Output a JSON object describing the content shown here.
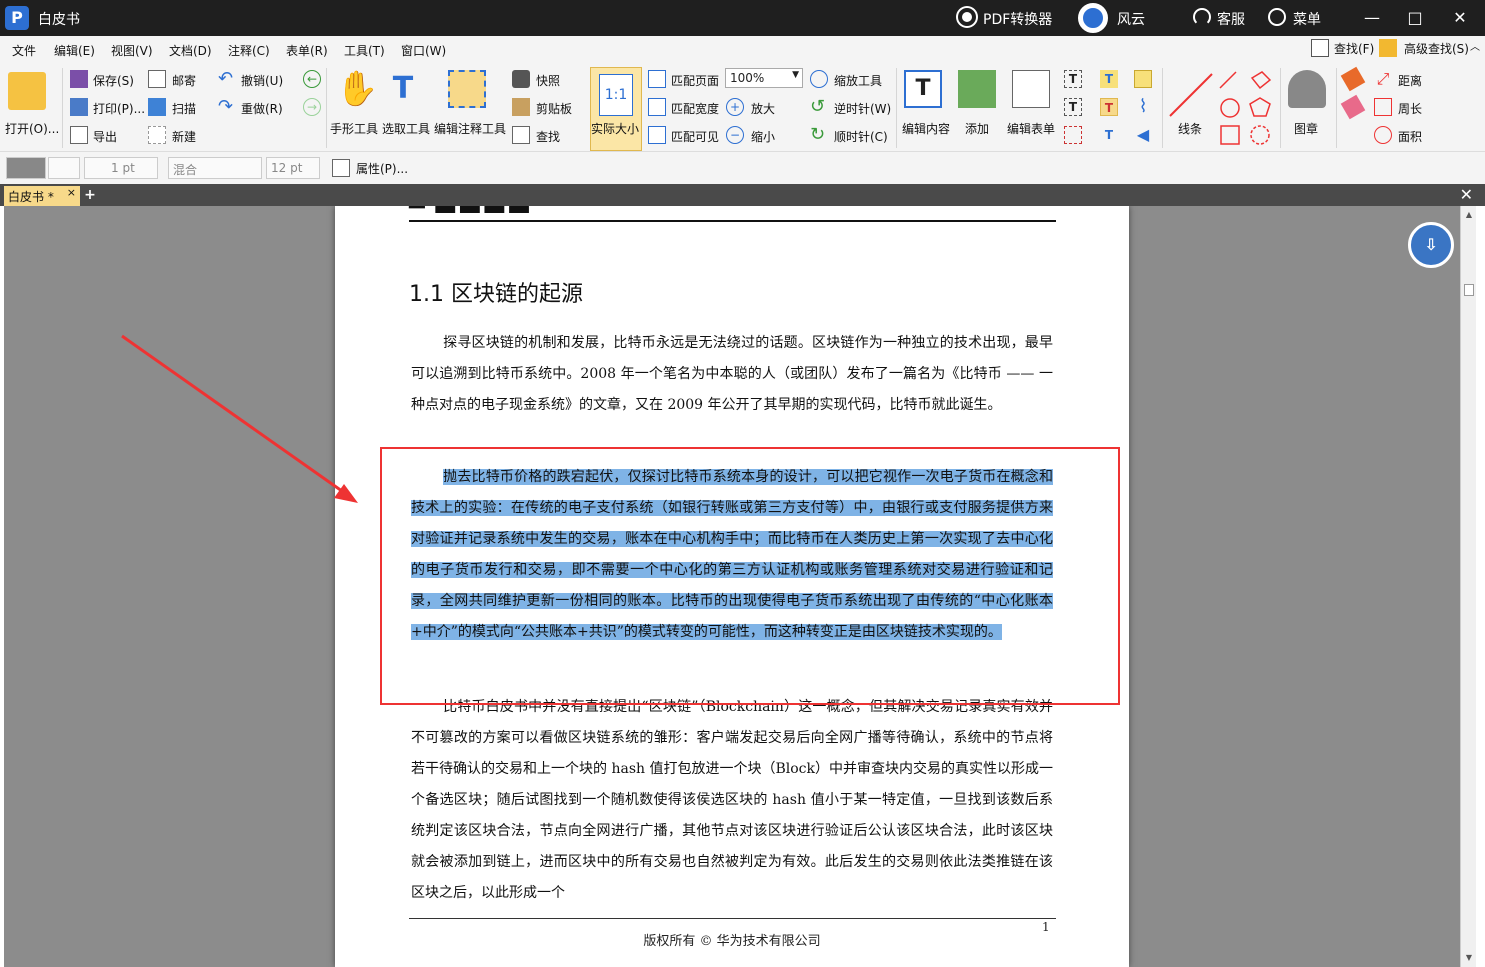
{
  "titlebar": {
    "doc_title": "白皮书",
    "pdf_converter": "PDF转换器",
    "fengyun": "风云",
    "service": "客服",
    "menu": "菜单"
  },
  "menubar": {
    "items": [
      "文件",
      "编辑(E)",
      "视图(V)",
      "文档(D)",
      "注释(C)",
      "表单(R)",
      "工具(T)",
      "窗口(W)"
    ],
    "find": "查找(F)",
    "advanced_find": "高级查找(S)"
  },
  "ribbon": {
    "open": "打开(O)...",
    "save": "保存(S)",
    "print": "打印(P)...",
    "export": "导出",
    "mail": "邮寄",
    "scan": "扫描",
    "new": "新建",
    "undo": "撤销(U)",
    "redo": "重做(R)",
    "hand_tool": "手形工具",
    "select_tool": "选取工具",
    "edit_annot_tool": "编辑注释工具",
    "snapshot": "快照",
    "clipboard": "剪贴板",
    "search": "查找",
    "actual_size": "实际大小",
    "fit_page": "匹配页面",
    "fit_width": "匹配宽度",
    "fit_visible": "匹配可见",
    "zoom_value": "100%",
    "zoom_in": "放大",
    "zoom_out": "缩小",
    "zoom_tool": "缩放工具",
    "rotate_ccw": "逆时针(W)",
    "rotate_cw": "顺时针(C)",
    "edit_content": "编辑内容",
    "add": "添加",
    "edit_form": "编辑表单",
    "lines": "线条",
    "stamp": "图章",
    "distance": "距离",
    "perimeter": "周长",
    "area": "面积"
  },
  "propbar": {
    "line_width": "1 pt",
    "blend": "混合",
    "font_size": "12 pt",
    "properties": "属性(P)..."
  },
  "tabs": {
    "active": "白皮书 *",
    "close": "×",
    "add": "+"
  },
  "document": {
    "section_title": "1.1 区块链的起源",
    "para1": "探寻区块链的机制和发展，比特币永远是无法绕过的话题。区块链作为一种独立的技术出现，最早可以追溯到比特币系统中。2008 年一个笔名为中本聪的人（或团队）发布了一篇名为《比特币 —— 一种点对点的电子现金系统》的文章，又在 2009 年公开了其早期的实现代码，比特币就此诞生。",
    "para2": "抛去比特币价格的跌宕起伏，仅探讨比特币系统本身的设计，可以把它视作一次电子货币在概念和技术上的实验：在传统的电子支付系统（如银行转账或第三方支付等）中，由银行或支付服务提供方来对验证并记录系统中发生的交易，账本在中心机构手中；而比特币在人类历史上第一次实现了去中心化的电子货币发行和交易，即不需要一个中心化的第三方认证机构或账务管理系统对交易进行验证和记录，全网共同维护更新一份相同的账本。比特币的出现使得电子货币系统出现了由传统的“中心化账本+中介”的模式向“公共账本+共识”的模式转变的可能性，而这种转变正是由区块链技术实现的。",
    "para3": "比特币白皮书中并没有直接提出“区块链”（Blockchain）这一概念，但其解决交易记录真实有效并不可篡改的方案可以看做区块链系统的雏形：客户端发起交易后向全网广播等待确认，系统中的节点将若干待确认的交易和上一个块的 hash 值打包放进一个块（Block）中并审查块内交易的真实性以形成一个备选区块；随后试图找到一个随机数使得该侯选区块的 hash 值小于某一特定值，一旦找到该数后系统判定该区块合法，节点向全网进行广播，其他节点对该区块进行验证后公认该区块合法，此时该区块就会被添加到链上，进而区块中的所有交易也自然被判定为有效。此后发生的交易则依此法类推链在该区块之后，以此形成一个",
    "page_number": "1",
    "copyright": "版权所有 © 华为技术有限公司"
  },
  "colors": {
    "highlight": "#7fb3e6",
    "annotation_red": "#e33333",
    "accent_blue": "#2d6fd2"
  }
}
